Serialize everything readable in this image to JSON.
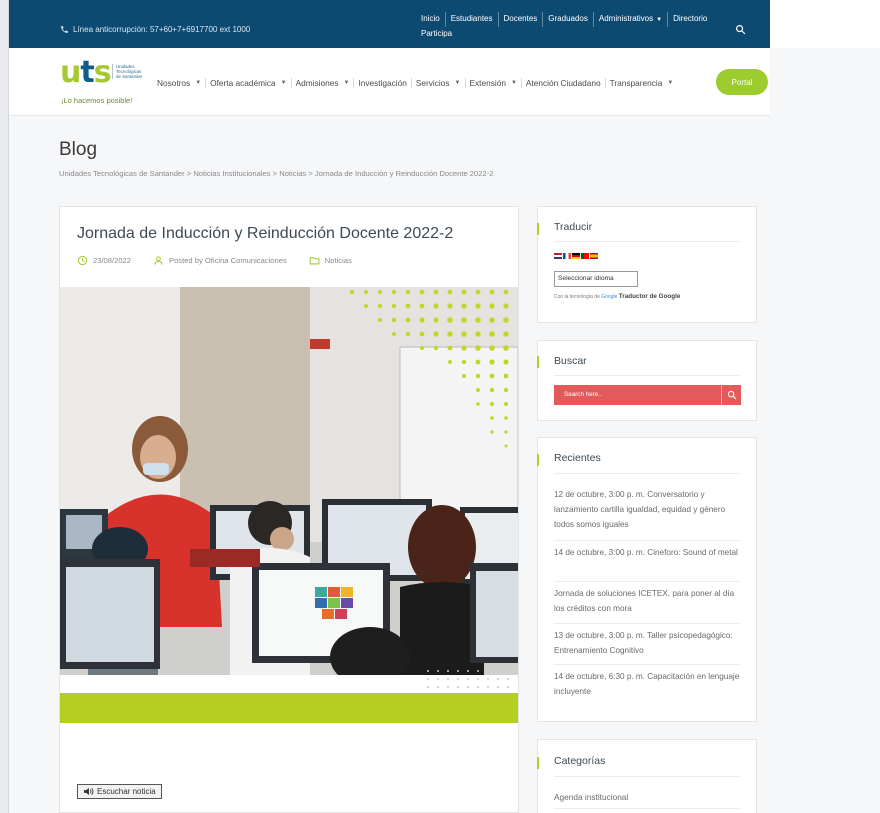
{
  "topbar": {
    "phone_text": "Línea anticorrupción: 57+60+7+6917700 ext 1000",
    "links": [
      "Inicio",
      "Estudiantes",
      "Docentes",
      "Graduados",
      "Administrativos",
      "Directorio",
      "Participa"
    ],
    "colors": {
      "background": "#0d4a72"
    }
  },
  "header": {
    "logo_text": "uts",
    "logo_subtitle": [
      "Unidades",
      "Tecnológicas",
      "de Santander"
    ],
    "slogan": "¡Lo hacemos posible!",
    "menu": [
      "Nosotros",
      "Oferta académica",
      "Admisiones",
      "Investigación",
      "Servicios",
      "Extensión",
      "Atención Ciudadano",
      "Transparencia"
    ],
    "portal_label": "Portal",
    "colors": {
      "accent": "#9ccc2e"
    }
  },
  "page": {
    "title": "Blog",
    "breadcrumb": "Unidades Tecnológicas de Santander > Noticias Institucionales > Noticias > Jornada de Inducción y Reinducción Docente 2022-2"
  },
  "article": {
    "title": "Jornada de Inducción y Reinducción Docente 2022-2",
    "date": "23/08/2022",
    "author": "Posted by Oficina Comunicaciones",
    "category": "Noticias",
    "listen_label": "Escuchar noticia",
    "colors": {
      "band": "#b4cf21",
      "meta_icon": "#a6c833"
    }
  },
  "sidebar": {
    "translate": {
      "title": "Traducir",
      "select_value": "Seleccionar idioma",
      "powered_prefix": "Con la tecnología de",
      "powered_brand": "Google",
      "powered_product": "Traductor de Google"
    },
    "search": {
      "title": "Buscar",
      "placeholder": "Search here..",
      "colors": {
        "background": "#e25a59"
      }
    },
    "recent": {
      "title": "Recientes",
      "items": [
        "12 de octubre, 3:00 p. m. Conversatorio y lanzamiento cartilla igualdad, equidad y género todos somos iguales",
        "14 de octubre, 3:00 p. m. Cineforo: Sound of metal",
        "Jornada de soluciones ICETEX, para poner al día los créditos con mora",
        "13 de octubre, 3:00 p. m. Taller psicopedagógico: Entrenamiento Cognitivo",
        "14 de octubre, 6:30 p. m. Capacitación en lenguaje incluyente"
      ]
    },
    "categories": {
      "title": "Categorías",
      "items": [
        "Agenda institucional"
      ]
    }
  },
  "icons": {
    "phone": "phone-icon",
    "search": "search-icon",
    "clock": "clock-icon",
    "user": "user-icon",
    "folder": "folder-icon",
    "speaker": "speaker-icon"
  }
}
